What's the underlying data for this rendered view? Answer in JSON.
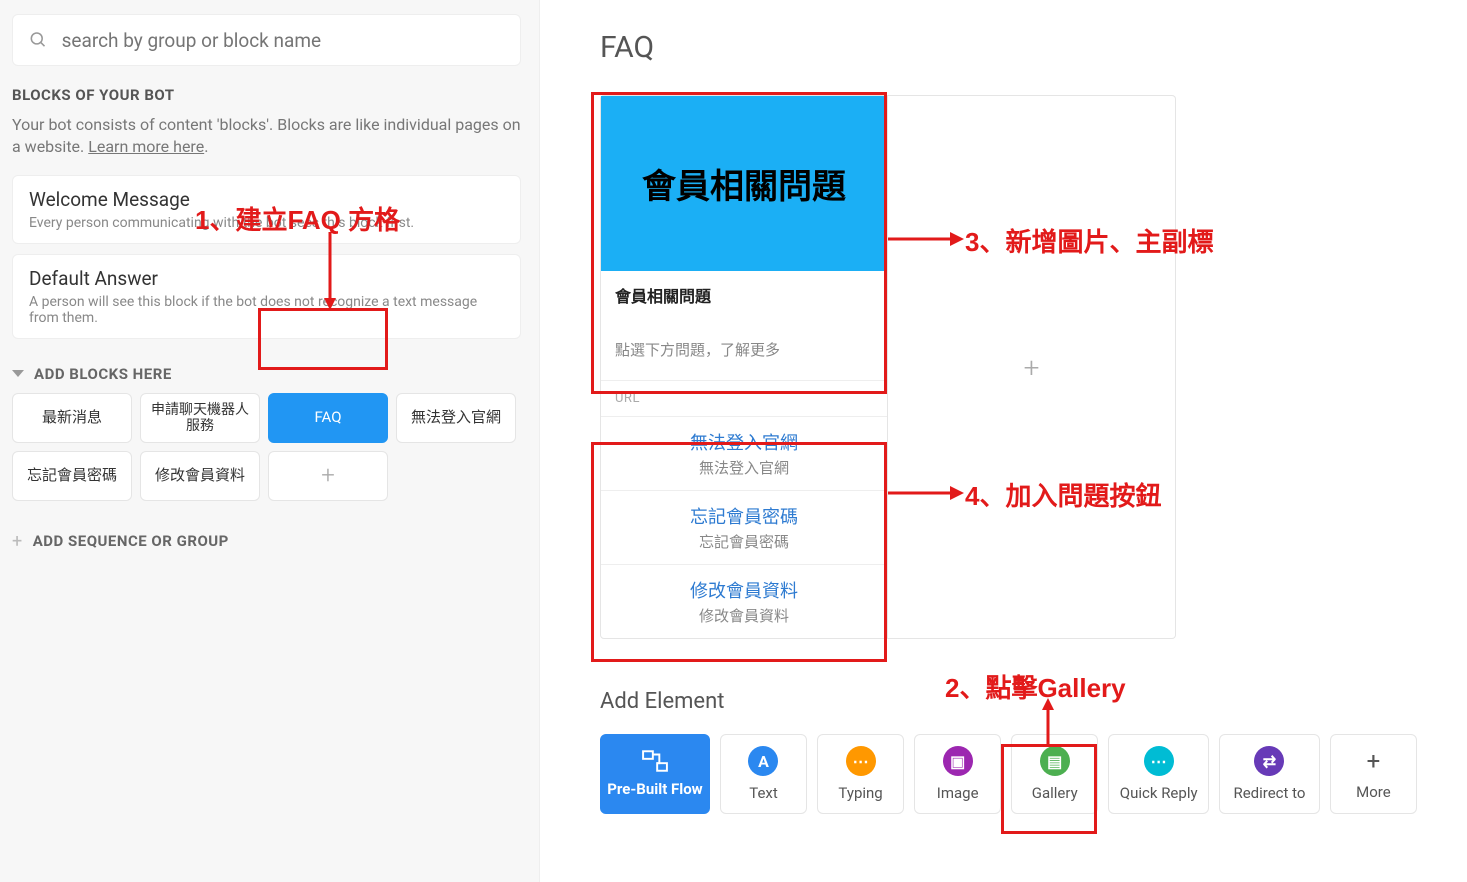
{
  "search": {
    "placeholder": "search by group or block name"
  },
  "sidebar": {
    "section_title": "BLOCKS OF YOUR BOT",
    "section_desc_a": "Your bot consists of content 'blocks'. Blocks are like individual pages on a website. ",
    "section_desc_link": "Learn more here",
    "section_desc_dot": ".",
    "welcome": {
      "title": "Welcome Message",
      "desc": "Every person communicating with the bot sees this block first."
    },
    "default": {
      "title": "Default Answer",
      "desc": "A person will see this block if the bot does not recognize a text message from them."
    },
    "group_label": "ADD BLOCKS HERE",
    "blocks": [
      "最新消息",
      "申請聊天機器人服務",
      "FAQ",
      "無法登入官網",
      "忘記會員密碼",
      "修改會員資料"
    ],
    "add_group": "ADD SEQUENCE OR GROUP"
  },
  "main": {
    "title": "FAQ",
    "card": {
      "image_text": "會員相關問題",
      "title": "會員相關問題",
      "subtitle": "點選下方問題，了解更多",
      "url_label": "URL",
      "buttons": [
        {
          "title": "無法登入官網",
          "sub": "無法登入官網"
        },
        {
          "title": "忘記會員密碼",
          "sub": "忘記會員密碼"
        },
        {
          "title": "修改會員資料",
          "sub": "修改會員資料"
        }
      ]
    },
    "add_element": "Add Element",
    "elements": {
      "prebuilt": "Pre-Built Flow",
      "text": "Text",
      "typing": "Typing",
      "image": "Image",
      "gallery": "Gallery",
      "quick": "Quick Reply",
      "redirect": "Redirect to",
      "more": "More"
    }
  },
  "annotations": {
    "a1": "1、建立FAQ 方格",
    "a2": "2、點擊Gallery",
    "a3": "3、新增圖片、主副標",
    "a4": "4、加入問題按鈕"
  }
}
